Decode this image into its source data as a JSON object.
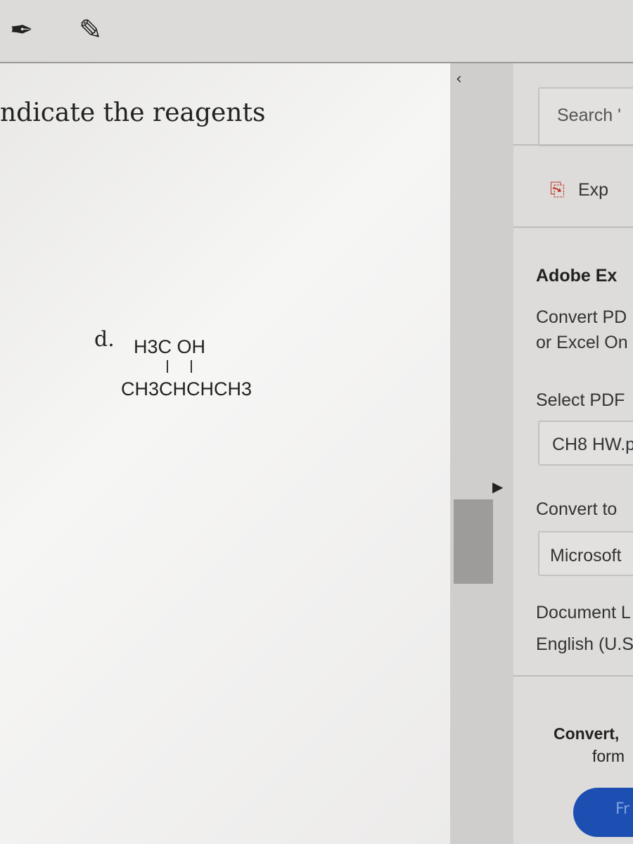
{
  "toolbar": {
    "icons": [
      "fill-sign-pen-icon",
      "edit-pdf-icon"
    ]
  },
  "document": {
    "heading": "ndicate the reagents",
    "item_label": "d.",
    "structure": {
      "top": "H3C  OH",
      "bottom": "CH3CHCHCH3"
    }
  },
  "panel": {
    "search_placeholder": "Search '",
    "export_label": "Exp",
    "title": "Adobe Ex",
    "desc_line1": "Convert PD",
    "desc_line2": "or Excel On",
    "select_pdf_label": "Select PDF",
    "selected_file": "CH8 HW.p",
    "convert_to_label": "Convert to",
    "convert_to_value": "Microsoft",
    "doc_lang_label": "Document L",
    "doc_lang_value": "English (U.S",
    "promo_line1": "Convert, ",
    "promo_line2": "form",
    "button_label": "Fr",
    "button_color": "#1d4fb3"
  }
}
